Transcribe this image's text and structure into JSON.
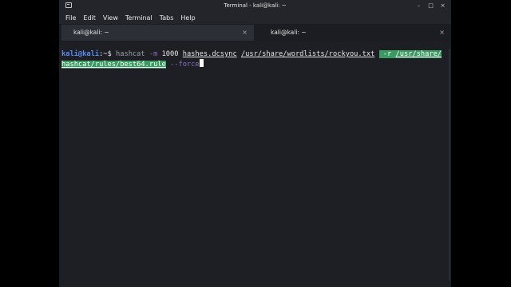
{
  "window": {
    "title": "Terminal - kali@kali: ~",
    "controls": {
      "minimize": "–",
      "maximize": "□",
      "close": "×"
    }
  },
  "menu": [
    "File",
    "Edit",
    "View",
    "Terminal",
    "Tabs",
    "Help"
  ],
  "tabs": [
    {
      "label": "kali@kali: ~",
      "close": "×"
    },
    {
      "label": "kali@kali: ~",
      "close": "×"
    }
  ],
  "terminal": {
    "prompt_user": "kali@kali",
    "prompt_path": ":~$ ",
    "cmd": "hashcat",
    "flag_m": "-m",
    "mode": "1000",
    "hashfile": "hashes.dcsync",
    "wordlist": "/usr/share/wordlists/rockyou.txt",
    "flag_r": "-r",
    "rule_part1": "/usr/share/",
    "rule_part2": "hashcat/rules/best64.rule",
    "flag_force": "--force"
  },
  "colors": {
    "prompt": "#5a8df2",
    "option": "#8b6dbf",
    "highlight": "#3a9a62",
    "background": "#1d1f24"
  },
  "icons": [
    "terminal-app-icon",
    "minimize-icon",
    "maximize-icon",
    "close-icon"
  ]
}
